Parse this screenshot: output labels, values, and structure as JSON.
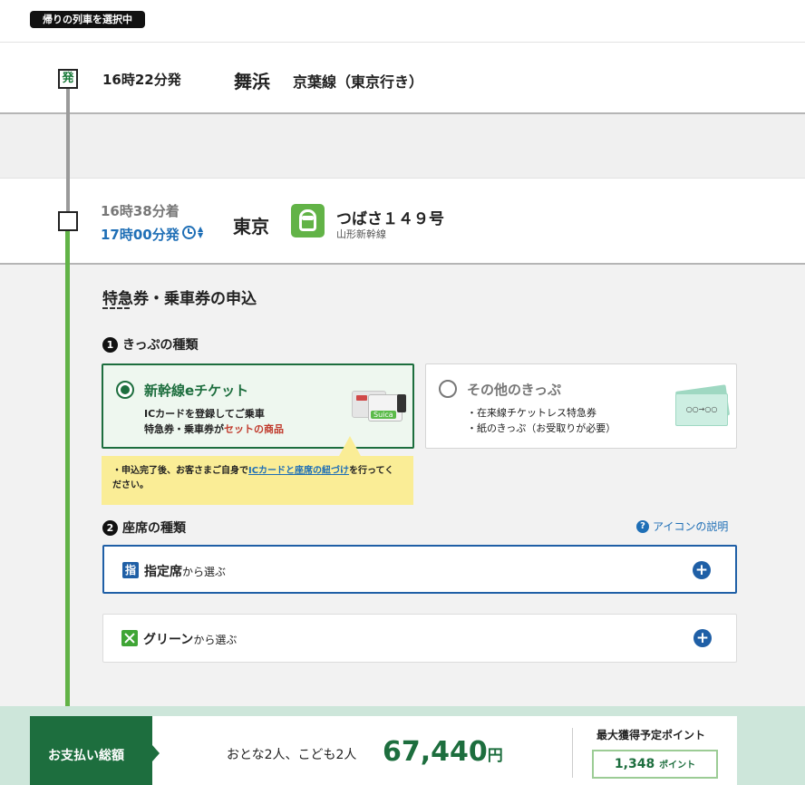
{
  "header": {
    "return_badge": "帰りの列車を選択中"
  },
  "departure": {
    "marker": "発",
    "time": "16時22分発",
    "station": "舞浜",
    "line": "京葉線（東京行き）"
  },
  "arrival": {
    "arr_time": "16時38分着",
    "dep_time": "17時00分発",
    "station": "東京",
    "train_name": "つばさ１４９号",
    "train_type": "山形新幹線"
  },
  "application": {
    "title": "特急券・乗車券の申込",
    "step1": {
      "num": "1",
      "label": "きっぷの種類"
    },
    "eticket": {
      "title": "新幹線eチケット",
      "line1": "ICカードを登録してご乗車",
      "line2_a": "特急券・乗車券が",
      "line2_b": "セットの商品",
      "card_badge": "Suica"
    },
    "other": {
      "title": "その他のきっぷ",
      "line1": "・在来線チケットレス特急券",
      "line2": "・紙のきっぷ（お受取りが必要）",
      "ticket_text": "○○→○○"
    },
    "note": {
      "prefix": "・申込完了後、お客さまご自身で",
      "link": "ICカードと座席の紐づけ",
      "suffix": "を行ってください。"
    },
    "step2": {
      "num": "2",
      "label": "座席の種類"
    },
    "help_link": "アイコンの説明",
    "seats": [
      {
        "icon_text": "指",
        "label": "指定席",
        "suffix": "から選ぶ"
      },
      {
        "icon_text": "",
        "label": "グリーン",
        "suffix": "から選ぶ"
      }
    ]
  },
  "footer": {
    "pay_label": "お支払い総額",
    "passengers": "おとな2人、こども2人",
    "total": "67,440",
    "currency": "円",
    "points_title": "最大獲得予定ポイント",
    "points": "1,348",
    "points_unit": "ポイント"
  },
  "colors": {
    "accent_green": "#1d6e3e",
    "line_green": "#62b347",
    "accent_blue": "#1f6fb6",
    "note_yellow": "#faed96"
  }
}
